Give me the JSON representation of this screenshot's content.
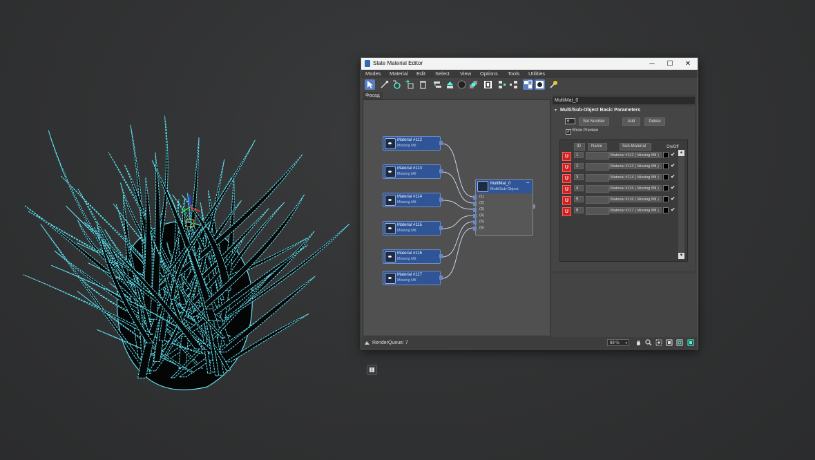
{
  "window": {
    "title": "Slate Material Editor",
    "minimize": "─",
    "maximize": "☐",
    "close": "✕"
  },
  "menu": [
    "Modes",
    "Material",
    "Edit",
    "Select",
    "View",
    "Options",
    "Tools",
    "Utilities"
  ],
  "toolbar_icons": [
    "select-tool-icon",
    "pick-material-icon",
    "put-to-scene-icon",
    "assign-to-selection-icon",
    "delete-icon",
    "move-children-icon",
    "hide-unused-icon",
    "show-shaded-icon",
    "show-background-icon",
    "show-end-result-icon",
    "layout-all-icon",
    "layout-children-icon",
    "material-map-navigator-icon",
    "parameter-editor-icon",
    "select-by-material-icon"
  ],
  "view_tab": "Фасад",
  "nodes": [
    {
      "name": "Material #112",
      "sub": "Missing Mtl"
    },
    {
      "name": "Material #113",
      "sub": "Missing Mtl"
    },
    {
      "name": "Material #114",
      "sub": "Missing Mtl"
    },
    {
      "name": "Material #115",
      "sub": "Missing Mtl"
    },
    {
      "name": "Material #116",
      "sub": "Missing Mtl"
    },
    {
      "name": "Material #117",
      "sub": "Missing Mtl"
    }
  ],
  "multimat_node": {
    "name": "MultiMat_0",
    "type": "Multi/Sub-Object",
    "collapse": "−",
    "slots": [
      "(1)",
      "(2)",
      "(3)",
      "(4)",
      "(5)",
      "(6)"
    ]
  },
  "status": {
    "render_queue": "RenderQueue: 7",
    "zoom": "89 %"
  },
  "params": {
    "material_name": "MultiMat_0",
    "rollout_title": "Multi/Sub-Object Basic Parameters",
    "count": "6",
    "set_number": "Set Number",
    "add": "Add",
    "delete": "Delete",
    "show_preview": "Show Preview",
    "headers": {
      "id": "ID",
      "name": "Name",
      "submaterial": "Sub-Material",
      "onoff": "On/Off"
    },
    "rows": [
      {
        "id": "1",
        "sub": "Material #112  ( Missing Mtl )"
      },
      {
        "id": "2",
        "sub": "Material #113  ( Missing Mtl )"
      },
      {
        "id": "3",
        "sub": "Material #114  ( Missing Mtl )"
      },
      {
        "id": "4",
        "sub": "Material #115  ( Missing Mtl )"
      },
      {
        "id": "5",
        "sub": "Material #116  ( Missing Mtl )"
      },
      {
        "id": "6",
        "sub": "Material #117  ( Missing Mtl )"
      }
    ],
    "check": "✔"
  },
  "colors": {
    "accent": "#2f5597",
    "outline": "#5fe3f2",
    "sample_red": "#d02020"
  }
}
